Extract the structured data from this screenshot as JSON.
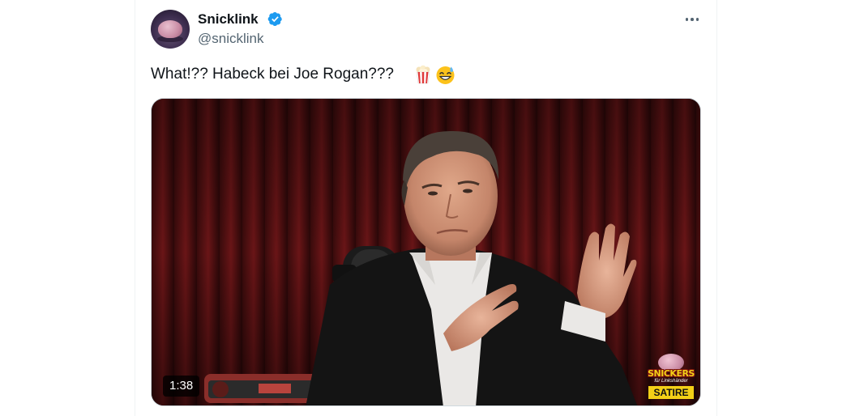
{
  "tweet": {
    "display_name": "Snicklink",
    "handle": "@snicklink",
    "verified": true,
    "text": "What!?? Habeck bei Joe Rogan???",
    "emojis": [
      "popcorn-icon",
      "sweat-smile-icon"
    ]
  },
  "media": {
    "type": "video",
    "duration": "1:38",
    "watermark": {
      "brand": "SNICKERS",
      "subtitle": "für Linkshänder",
      "label": "SATIRE"
    }
  },
  "colors": {
    "text_primary": "#0f1419",
    "text_secondary": "#536471",
    "verified_blue": "#1d9bf0",
    "border": "#cfd9de",
    "watermark_yellow": "#f3d017"
  }
}
